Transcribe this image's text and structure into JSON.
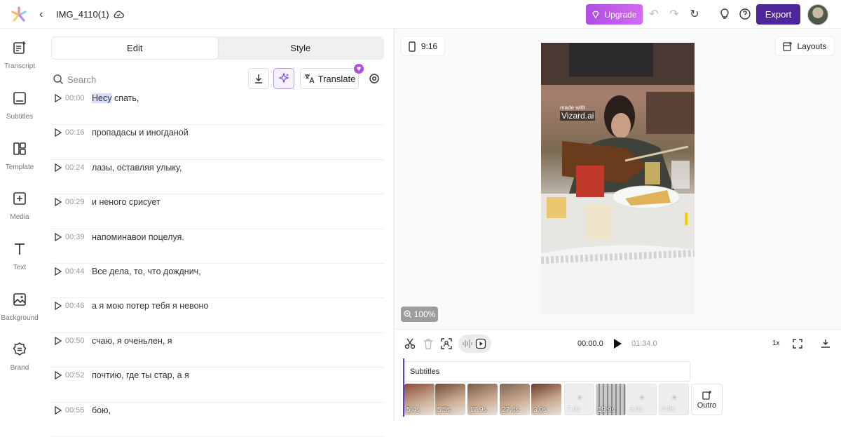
{
  "header": {
    "project_name": "IMG_4110(1)",
    "upgrade_label": "Upgrade",
    "export_label": "Export"
  },
  "colors": {
    "accent_purple": "#4b2799",
    "upgrade_gradient": "#b14de0",
    "highlight": "#d6dcf7"
  },
  "sidebar": {
    "items": [
      {
        "label": "Transcript",
        "icon": "transcript-icon"
      },
      {
        "label": "Subtitles",
        "icon": "subtitles-icon"
      },
      {
        "label": "Template",
        "icon": "template-icon"
      },
      {
        "label": "Media",
        "icon": "media-icon"
      },
      {
        "label": "Text",
        "icon": "text-icon"
      },
      {
        "label": "Background",
        "icon": "background-icon"
      },
      {
        "label": "Brand",
        "icon": "brand-icon"
      }
    ]
  },
  "editor": {
    "tabs": [
      "Edit",
      "Style"
    ],
    "search_placeholder": "Search",
    "translate_label": "Translate"
  },
  "transcript": [
    {
      "time": "00:00",
      "pre": "",
      "highlight": "Несу",
      "text": " спать,"
    },
    {
      "time": "00:16",
      "pre": "",
      "highlight": "",
      "text": "пропадасы и иногданой"
    },
    {
      "time": "00:24",
      "pre": "",
      "highlight": "",
      "text": "лазы, оставляя улыку,"
    },
    {
      "time": "00:29",
      "pre": "",
      "highlight": "",
      "text": "и неного срисует"
    },
    {
      "time": "00:39",
      "pre": "",
      "highlight": "",
      "text": "напоминавои поцелуя."
    },
    {
      "time": "00:44",
      "pre": "",
      "highlight": "",
      "text": "Все дела, то, что дожднич,"
    },
    {
      "time": "00:46",
      "pre": "",
      "highlight": "",
      "text": "а я мою потер тебя я невоно"
    },
    {
      "time": "00:50",
      "pre": "",
      "highlight": "",
      "text": "счаю, я оченьлен, я"
    },
    {
      "time": "00:52",
      "pre": "",
      "highlight": "",
      "text": "почтию, где ты стар, а я"
    },
    {
      "time": "00:55",
      "pre": "",
      "highlight": "",
      "text": "бою,"
    }
  ],
  "preview": {
    "aspect_ratio": "9:16",
    "layouts_label": "Layouts",
    "zoom": "100%",
    "watermark_top": "made with",
    "watermark_brand": "Vizard.ai"
  },
  "timeline": {
    "current_time": "00:00.0",
    "duration": "01:34.0",
    "speed": "1x",
    "subtitles_track": "Subtitles",
    "clips": [
      "5.4s",
      "5.5s",
      "17.9s",
      "27.4s",
      "3.0s",
      "7.0s",
      "19.9s",
      "3.0s",
      "4.9s"
    ],
    "outro_label": "Outro"
  }
}
